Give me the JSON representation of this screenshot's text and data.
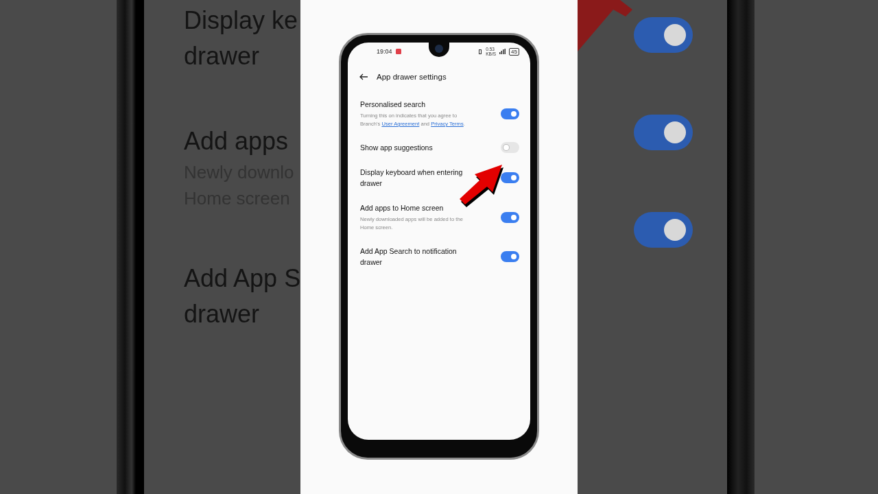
{
  "backdrop_left": {
    "items": [
      {
        "title": "Display ke",
        "subtitle": "drawer"
      },
      {
        "title": "Add apps",
        "description": "Newly downlo",
        "description_2": "Home screen"
      },
      {
        "title": "Add App S",
        "subtitle": "drawer"
      }
    ]
  },
  "backdrop_right": {
    "toggles": [
      {
        "on": true
      },
      {
        "on": true
      },
      {
        "on": true
      }
    ]
  },
  "status_bar": {
    "time": "19:04",
    "speed": "0.53",
    "speed_unit": "KB/S",
    "battery": "45"
  },
  "header": {
    "title": "App drawer settings"
  },
  "settings": [
    {
      "title": "Personalised search",
      "description": [
        {
          "kind": "text",
          "text": "Turning this on indicates that you agree to Branch's "
        },
        {
          "kind": "link",
          "text": "User Agreement"
        },
        {
          "kind": "text",
          "text": " and "
        },
        {
          "kind": "link",
          "text": "Privacy Terms"
        },
        {
          "kind": "text",
          "text": "."
        }
      ],
      "on": true
    },
    {
      "title": "Show app suggestions",
      "on": false
    },
    {
      "title": "Display keyboard when entering drawer",
      "on": true
    },
    {
      "title": "Add apps to Home screen",
      "description": [
        {
          "kind": "text",
          "text": "Newly downloaded apps will be added to the Home screen."
        }
      ],
      "on": true
    },
    {
      "title": "Add App Search to notification drawer",
      "on": true
    }
  ]
}
